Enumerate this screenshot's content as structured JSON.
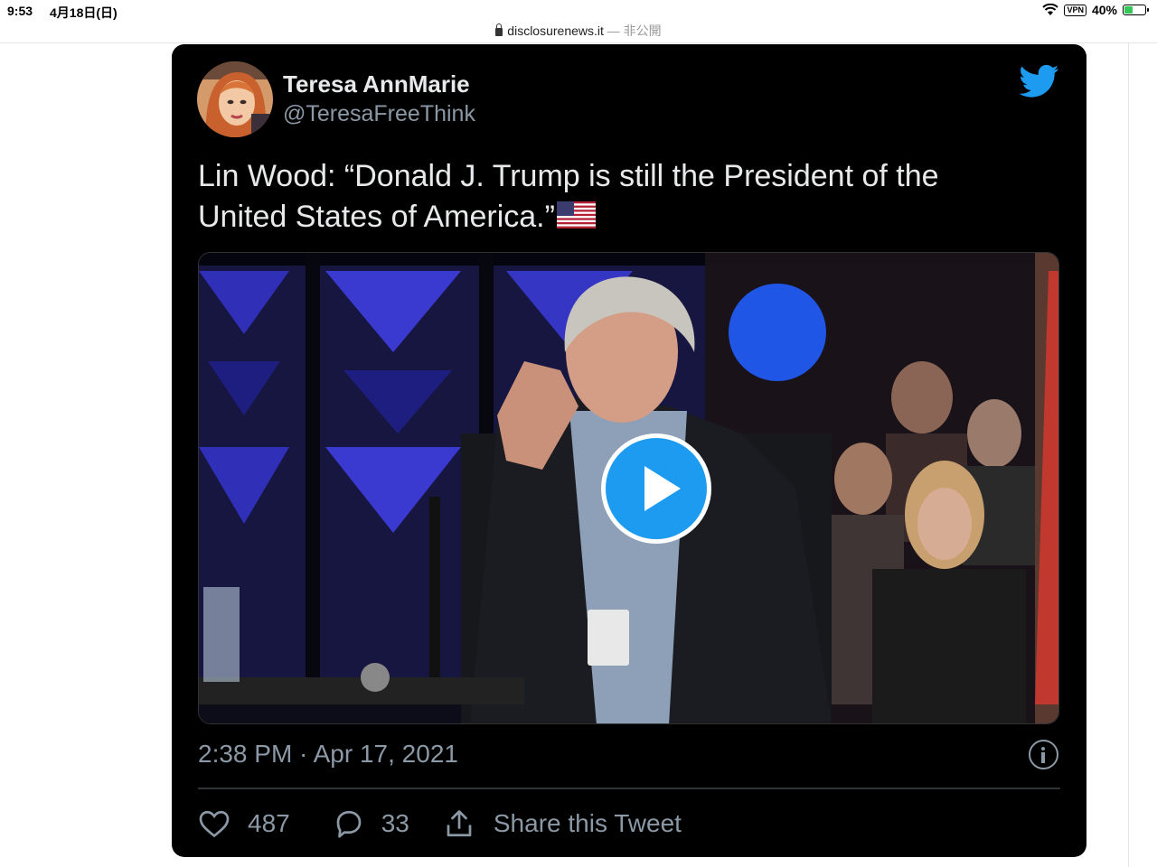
{
  "status_bar": {
    "time": "9:53",
    "date": "4月18日(日)",
    "vpn": "VPN",
    "battery": "40%",
    "battery_level": 0.4
  },
  "browser": {
    "domain": "disclosurenews.it",
    "privacy": "— 非公開"
  },
  "tweet": {
    "author_name": "Teresa AnnMarie",
    "author_handle": "@TeresaFreeThink",
    "text": "Lin Wood: “Donald J. Trump is still the President of the United States of America.”",
    "timestamp": "2:38 PM · Apr 17, 2021",
    "likes": "487",
    "replies": "33",
    "share_label": "Share this Tweet"
  },
  "colors": {
    "twitter_blue": "#1d9bf0",
    "card_background": "#000000",
    "secondary_text": "#8b98a5"
  },
  "icons": [
    "lock-icon",
    "wifi-icon",
    "battery-icon",
    "twitter-bird-icon",
    "play-icon",
    "info-icon",
    "heart-icon",
    "reply-icon",
    "share-icon"
  ]
}
